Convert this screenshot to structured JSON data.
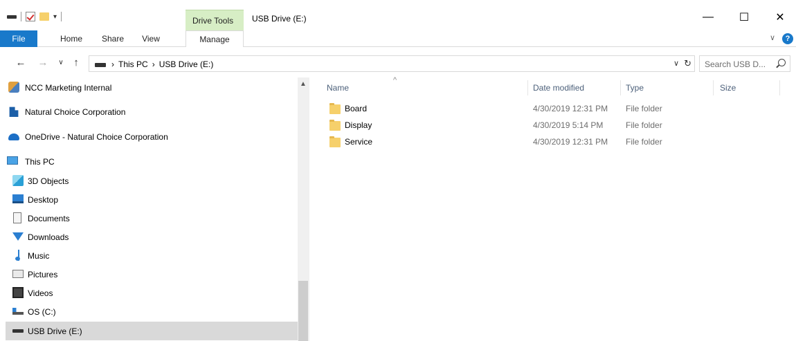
{
  "window": {
    "title": "USB Drive (E:)",
    "context_tab": "Drive Tools",
    "minimize": "—",
    "maximize": "☐",
    "close": "✕"
  },
  "ribbon": {
    "tabs": [
      "File",
      "Home",
      "Share",
      "View",
      "Manage"
    ],
    "expand_icon": "chevron-down-icon",
    "help": "?"
  },
  "address": {
    "crumbs": [
      "This PC",
      "USB Drive (E:)"
    ],
    "separator": "›",
    "search_placeholder": "Search USB D..."
  },
  "nav": {
    "items": [
      {
        "label": "NCC Marketing Internal",
        "icon": "people-icon"
      },
      {
        "label": "Natural Choice Corporation",
        "icon": "building-icon"
      },
      {
        "label": "OneDrive - Natural Choice Corporation",
        "icon": "onedrive-cloud-icon"
      },
      {
        "label": "This PC",
        "icon": "this-pc-icon"
      },
      {
        "label": "3D Objects",
        "icon": "3d-objects-icon"
      },
      {
        "label": "Desktop",
        "icon": "desktop-icon"
      },
      {
        "label": "Documents",
        "icon": "documents-icon"
      },
      {
        "label": "Downloads",
        "icon": "downloads-icon"
      },
      {
        "label": "Music",
        "icon": "music-icon"
      },
      {
        "label": "Pictures",
        "icon": "pictures-icon"
      },
      {
        "label": "Videos",
        "icon": "videos-icon"
      },
      {
        "label": "OS (C:)",
        "icon": "os-drive-icon"
      },
      {
        "label": "USB Drive (E:)",
        "icon": "usb-drive-icon",
        "selected": true
      }
    ]
  },
  "list": {
    "columns": [
      "Name",
      "Date modified",
      "Type",
      "Size"
    ],
    "rows": [
      {
        "name": "Board",
        "date": "4/30/2019 12:31 PM",
        "type": "File folder"
      },
      {
        "name": "Display",
        "date": "4/30/2019 5:14 PM",
        "type": "File folder"
      },
      {
        "name": "Service",
        "date": "4/30/2019 12:31 PM",
        "type": "File folder"
      }
    ]
  },
  "colors": {
    "file_tab": "#1979ca",
    "context_tab": "#d7eec5",
    "selected_nav": "#d9d9d9",
    "folder": "#f6d06b"
  }
}
